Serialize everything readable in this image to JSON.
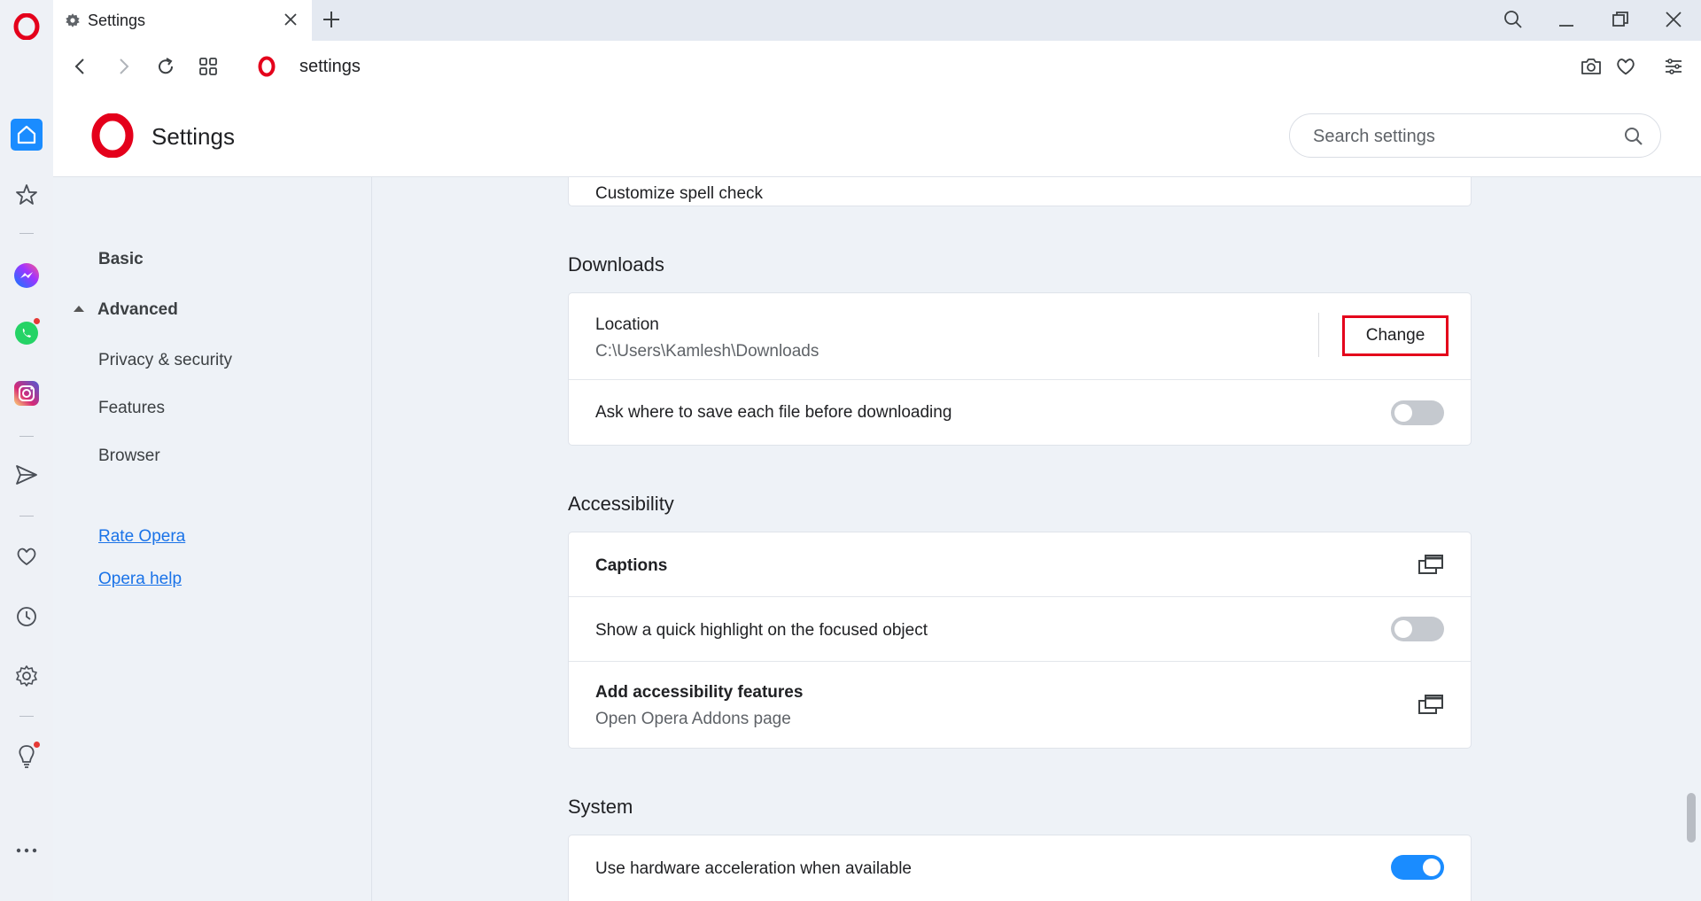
{
  "tab": {
    "title": "Settings"
  },
  "address": {
    "url": "settings"
  },
  "header": {
    "title": "Settings",
    "search_placeholder": "Search settings"
  },
  "nav": {
    "basic": "Basic",
    "advanced": "Advanced",
    "sub_items": [
      "Privacy & security",
      "Features",
      "Browser"
    ],
    "links": [
      "Rate Opera",
      "Opera help"
    ]
  },
  "main": {
    "prev_row_label": "Customize spell check",
    "downloads": {
      "title": "Downloads",
      "location_label": "Location",
      "location_path": "C:\\Users\\Kamlesh\\Downloads",
      "change_label": "Change",
      "ask_label": "Ask where to save each file before downloading",
      "ask_enabled": false
    },
    "accessibility": {
      "title": "Accessibility",
      "captions_label": "Captions",
      "highlight_label": "Show a quick highlight on the focused object",
      "highlight_enabled": false,
      "addons_label": "Add accessibility features",
      "addons_sub": "Open Opera Addons page"
    },
    "system": {
      "title": "System",
      "hw_accel_label": "Use hardware acceleration when available",
      "hw_accel_enabled": true
    }
  },
  "colors": {
    "accent": "#1a8cff",
    "opera_red": "#e4001b",
    "link": "#1a73e8"
  },
  "icons": [
    "opera-logo",
    "home-icon",
    "star-icon",
    "messenger-icon",
    "whatsapp-icon",
    "instagram-icon",
    "send-icon",
    "heart-icon",
    "history-icon",
    "gear-icon",
    "lightbulb-icon",
    "more-icon"
  ]
}
